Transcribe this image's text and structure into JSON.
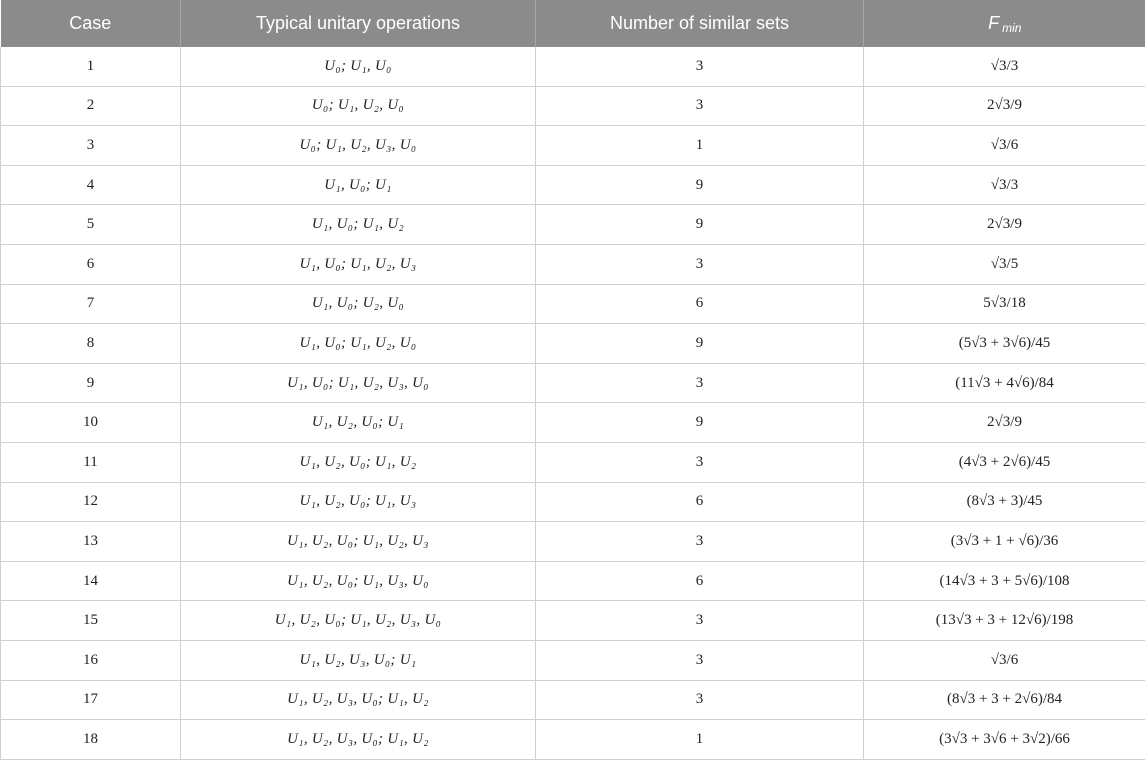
{
  "header": {
    "case": "Case",
    "ops": "Typical unitary operations",
    "sets": "Number of similar sets",
    "fmin_main": "F",
    "fmin_sub": "min"
  },
  "rows": [
    {
      "case": "1",
      "ops": "U₀; U₁, U₀",
      "sets": "3",
      "fmin": "√3/3"
    },
    {
      "case": "2",
      "ops": "U₀; U₁, U₂, U₀",
      "sets": "3",
      "fmin": "2√3/9"
    },
    {
      "case": "3",
      "ops": "U₀; U₁, U₂, U₃, U₀",
      "sets": "1",
      "fmin": "√3/6"
    },
    {
      "case": "4",
      "ops": "U₁, U₀; U₁",
      "sets": "9",
      "fmin": "√3/3"
    },
    {
      "case": "5",
      "ops": "U₁, U₀; U₁, U₂",
      "sets": "9",
      "fmin": "2√3/9"
    },
    {
      "case": "6",
      "ops": "U₁, U₀; U₁, U₂, U₃",
      "sets": "3",
      "fmin": "√3/5"
    },
    {
      "case": "7",
      "ops": "U₁, U₀; U₂, U₀",
      "sets": "6",
      "fmin": "5√3/18"
    },
    {
      "case": "8",
      "ops": "U₁, U₀; U₁, U₂, U₀",
      "sets": "9",
      "fmin": "(5√3 + 3√6)/45"
    },
    {
      "case": "9",
      "ops": "U₁, U₀; U₁, U₂, U₃, U₀",
      "sets": "3",
      "fmin": "(11√3 + 4√6)/84"
    },
    {
      "case": "10",
      "ops": "U₁, U₂, U₀; U₁",
      "sets": "9",
      "fmin": "2√3/9"
    },
    {
      "case": "11",
      "ops": "U₁, U₂, U₀; U₁, U₂",
      "sets": "3",
      "fmin": "(4√3 + 2√6)/45"
    },
    {
      "case": "12",
      "ops": "U₁, U₂, U₀; U₁, U₃",
      "sets": "6",
      "fmin": "(8√3 + 3)/45"
    },
    {
      "case": "13",
      "ops": "U₁, U₂, U₀; U₁, U₂, U₃",
      "sets": "3",
      "fmin": "(3√3 + 1 + √6)/36"
    },
    {
      "case": "14",
      "ops": "U₁, U₂, U₀; U₁, U₃, U₀",
      "sets": "6",
      "fmin": "(14√3 + 3 + 5√6)/108"
    },
    {
      "case": "15",
      "ops": "U₁, U₂, U₀; U₁, U₂, U₃, U₀",
      "sets": "3",
      "fmin": "(13√3 + 3 + 12√6)/198"
    },
    {
      "case": "16",
      "ops": "U₁, U₂, U₃, U₀; U₁",
      "sets": "3",
      "fmin": "√3/6"
    },
    {
      "case": "17",
      "ops": "U₁, U₂, U₃, U₀; U₁, U₂",
      "sets": "3",
      "fmin": "(8√3 + 3 + 2√6)/84"
    },
    {
      "case": "18",
      "ops": "U₁, U₂, U₃, U₀; U₁, U₂",
      "sets": "1",
      "fmin": "(3√3 + 3√6 + 3√2)/66"
    }
  ]
}
